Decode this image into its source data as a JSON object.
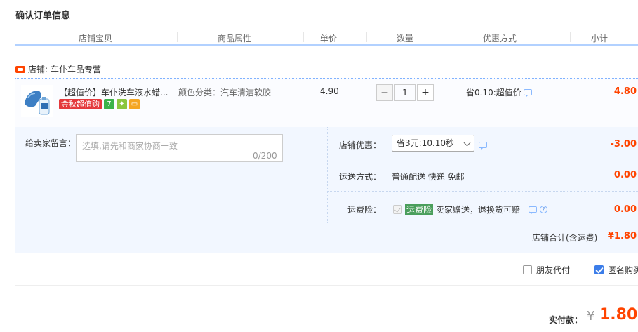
{
  "page": {
    "title": "确认订单信息"
  },
  "columns": [
    "店铺宝贝",
    "商品属性",
    "单价",
    "数量",
    "优惠方式",
    "小计"
  ],
  "shop": {
    "prefix": "店铺:",
    "name": "车仆车品专营"
  },
  "item": {
    "title": "【超值价】车仆洗车液水蜡...",
    "badge_text": "金秋超值购",
    "badge_icons": [
      "seven-day-return-icon",
      "guarantee-icon",
      "credit-card-icon"
    ],
    "attribute": "颜色分类：汽车清洁软胶",
    "unit_price": "4.90",
    "quantity": "1",
    "minus": "−",
    "plus": "+",
    "promotion": "省0.10:超值价",
    "subtotal": "4.80"
  },
  "message": {
    "label": "给卖家留言：",
    "placeholder": "选填,请先和商家协商一致",
    "counter": "0/200"
  },
  "shop_discount": {
    "label": "店铺优惠：",
    "selected": "省3元:10.10秒",
    "amount": "-3.00"
  },
  "shipping": {
    "label": "运送方式：",
    "value": "普通配送 快递 免邮",
    "amount": "0.00"
  },
  "insurance": {
    "label": "运费险：",
    "tag": "运费险",
    "desc": "卖家赠送，退换货可赔",
    "amount": "0.00"
  },
  "shop_total": {
    "label": "店铺合计(含运费)",
    "value": "¥1.80"
  },
  "options": {
    "friend_pay": "朋友代付",
    "anonymous": "匿名购买"
  },
  "payment": {
    "label": "实付款：",
    "currency": "¥",
    "value": "1.80"
  },
  "colors": {
    "accent": "#ff4400",
    "blue_line": "#b2d1ff",
    "panel_bg": "#f2f7ff",
    "insurance_tag": "#4a9e5c"
  }
}
